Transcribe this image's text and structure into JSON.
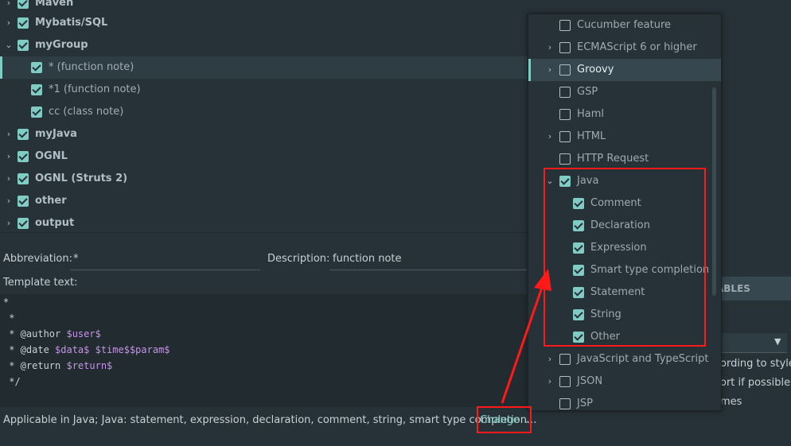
{
  "tree": {
    "rows": [
      {
        "label": "Maven",
        "arrow": "›",
        "checked": true
      },
      {
        "label": "Mybatis/SQL",
        "arrow": "›",
        "checked": true
      },
      {
        "label": "myGroup",
        "arrow": "⌄",
        "checked": true
      },
      {
        "label": "* (function note)",
        "arrow": "",
        "checked": true
      },
      {
        "label": "*1 (function note)",
        "arrow": "",
        "checked": true
      },
      {
        "label": "cc (class note)",
        "arrow": "",
        "checked": true
      },
      {
        "label": "myJava",
        "arrow": "›",
        "checked": true
      },
      {
        "label": "OGNL",
        "arrow": "›",
        "checked": true
      },
      {
        "label": "OGNL (Struts 2)",
        "arrow": "›",
        "checked": true
      },
      {
        "label": "other",
        "arrow": "›",
        "checked": true
      },
      {
        "label": "output",
        "arrow": "›",
        "checked": true
      }
    ]
  },
  "editor": {
    "abbreviation_label": "Abbreviation:",
    "abbreviation_value": "*",
    "description_label": "Description:",
    "description_value": "function note",
    "template_label": "Template text:",
    "code": {
      "l1": "*",
      "l2": " *",
      "l3_pre": " * @author ",
      "l3_var": "$user$",
      "l4_pre": " * @date ",
      "l4_var": "$data$ $time$$param$",
      "l5_pre": " * @return ",
      "l5_var": "$return$",
      "l6": " */"
    },
    "applicable_text": "Applicable in Java; Java: statement, expression, declaration, comment, string, smart type completion...",
    "change_label": "Change",
    "change_chevron": "⌄"
  },
  "right_panel": {
    "tab_label": "ABLES",
    "dropdown_arrow": "▼",
    "option1": "ording to style",
    "option2": "ort if possible",
    "option3": "mes"
  },
  "popup": {
    "items": [
      {
        "label": "Cucumber feature",
        "arrow": "",
        "checked": false
      },
      {
        "label": "ECMAScript 6 or higher",
        "arrow": "›",
        "checked": false
      },
      {
        "label": "Groovy",
        "arrow": "›",
        "checked": false
      },
      {
        "label": "GSP",
        "arrow": "",
        "checked": false
      },
      {
        "label": "Haml",
        "arrow": "",
        "checked": false
      },
      {
        "label": "HTML",
        "arrow": "›",
        "checked": false
      },
      {
        "label": "HTTP Request",
        "arrow": "",
        "checked": false
      },
      {
        "label": "Java",
        "arrow": "⌄",
        "checked": true
      },
      {
        "label": "Comment",
        "arrow": "",
        "checked": true
      },
      {
        "label": "Declaration",
        "arrow": "",
        "checked": true
      },
      {
        "label": "Expression",
        "arrow": "",
        "checked": true
      },
      {
        "label": "Smart type completion",
        "arrow": "",
        "checked": true
      },
      {
        "label": "Statement",
        "arrow": "",
        "checked": true
      },
      {
        "label": "String",
        "arrow": "",
        "checked": true
      },
      {
        "label": "Other",
        "arrow": "",
        "checked": true
      },
      {
        "label": "JavaScript and TypeScript",
        "arrow": "›",
        "checked": false
      },
      {
        "label": "JSON",
        "arrow": "›",
        "checked": false
      },
      {
        "label": "JSP",
        "arrow": "",
        "checked": false
      }
    ]
  },
  "colors": {
    "accent": "#80cbc4",
    "background": "#263238",
    "annotation_red": "#ff1a1a"
  }
}
